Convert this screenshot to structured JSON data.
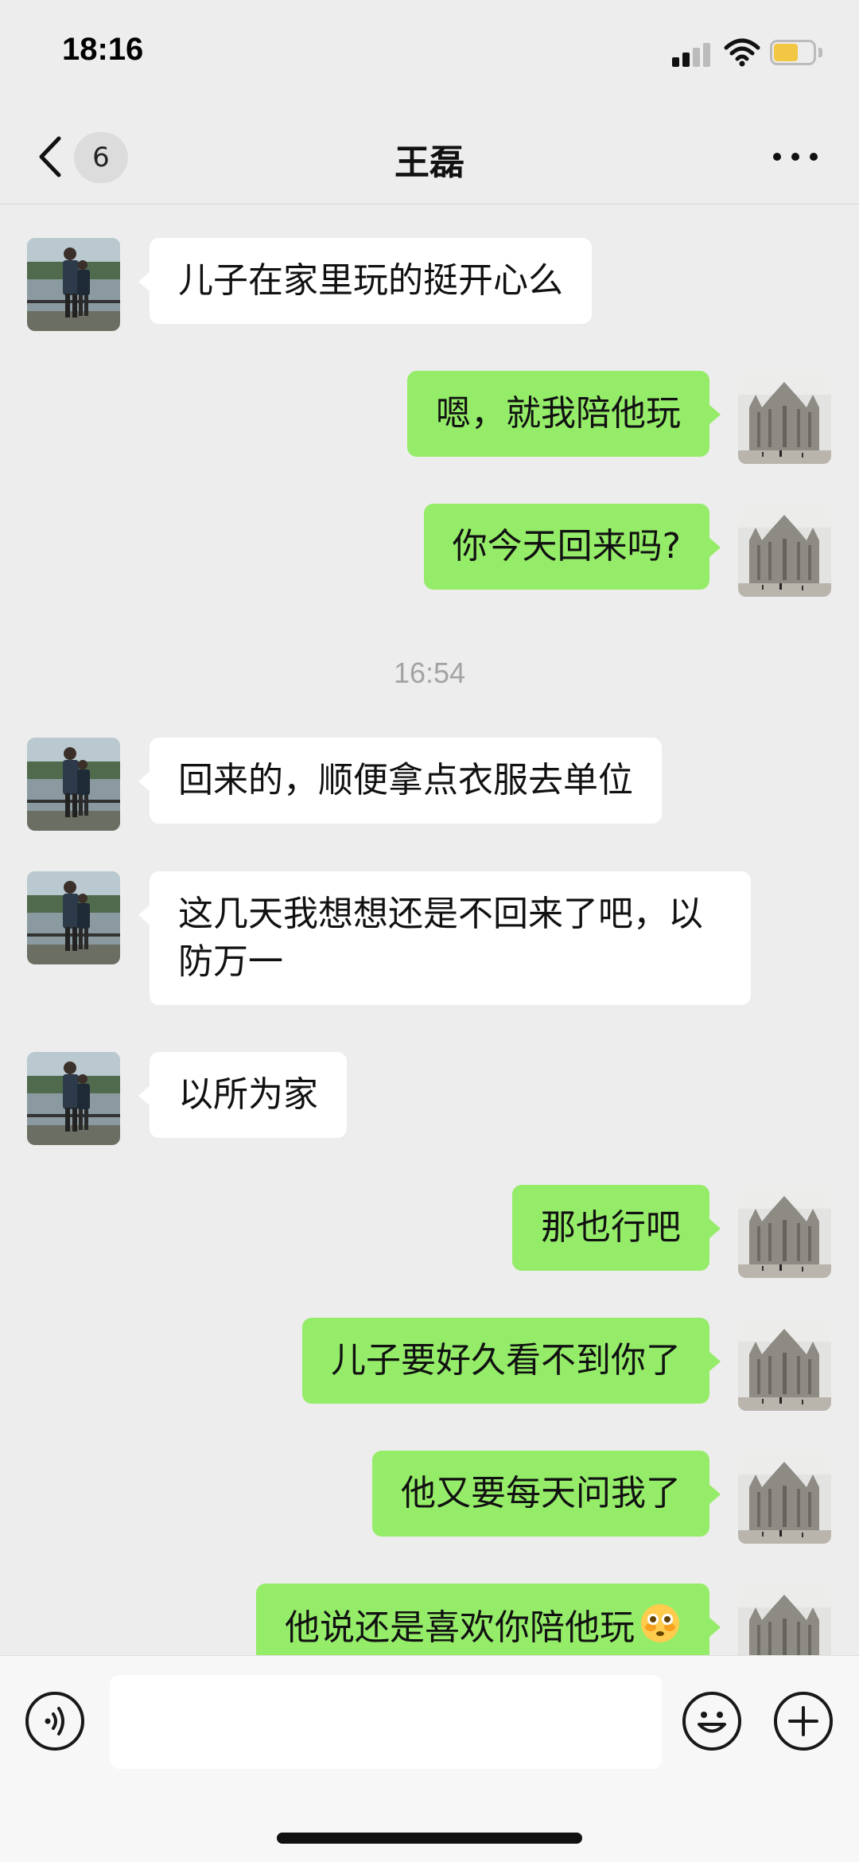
{
  "status_bar": {
    "time": "18:16"
  },
  "nav": {
    "unread_count": "6",
    "title": "王磊"
  },
  "messages": [
    {
      "side": "in",
      "text": "儿子在家里玩的挺开心么"
    },
    {
      "side": "out",
      "text": "嗯，就我陪他玩"
    },
    {
      "side": "out",
      "text": "你今天回来吗?"
    },
    {
      "side": "time",
      "text": "16:54"
    },
    {
      "side": "in",
      "text": "回来的，顺便拿点衣服去单位"
    },
    {
      "side": "in",
      "text": "这几天我想想还是不回来了吧，以防万一"
    },
    {
      "side": "in",
      "text": "以所为家"
    },
    {
      "side": "out",
      "text": "那也行吧"
    },
    {
      "side": "out",
      "text": "儿子要好久看不到你了"
    },
    {
      "side": "out",
      "text": "他又要每天问我了"
    },
    {
      "side": "out",
      "text": "他说还是喜欢你陪他玩",
      "emoji": "flushed-face"
    }
  ],
  "input": {
    "value": ""
  },
  "icons": {
    "back": "chevron-left-icon",
    "more": "more-dots-icon",
    "voice": "voice-icon",
    "emoji": "smiley-icon",
    "plus": "plus-icon"
  },
  "colors": {
    "outgoing_bubble": "#95ec69",
    "incoming_bubble": "#ffffff",
    "background": "#ededed"
  }
}
